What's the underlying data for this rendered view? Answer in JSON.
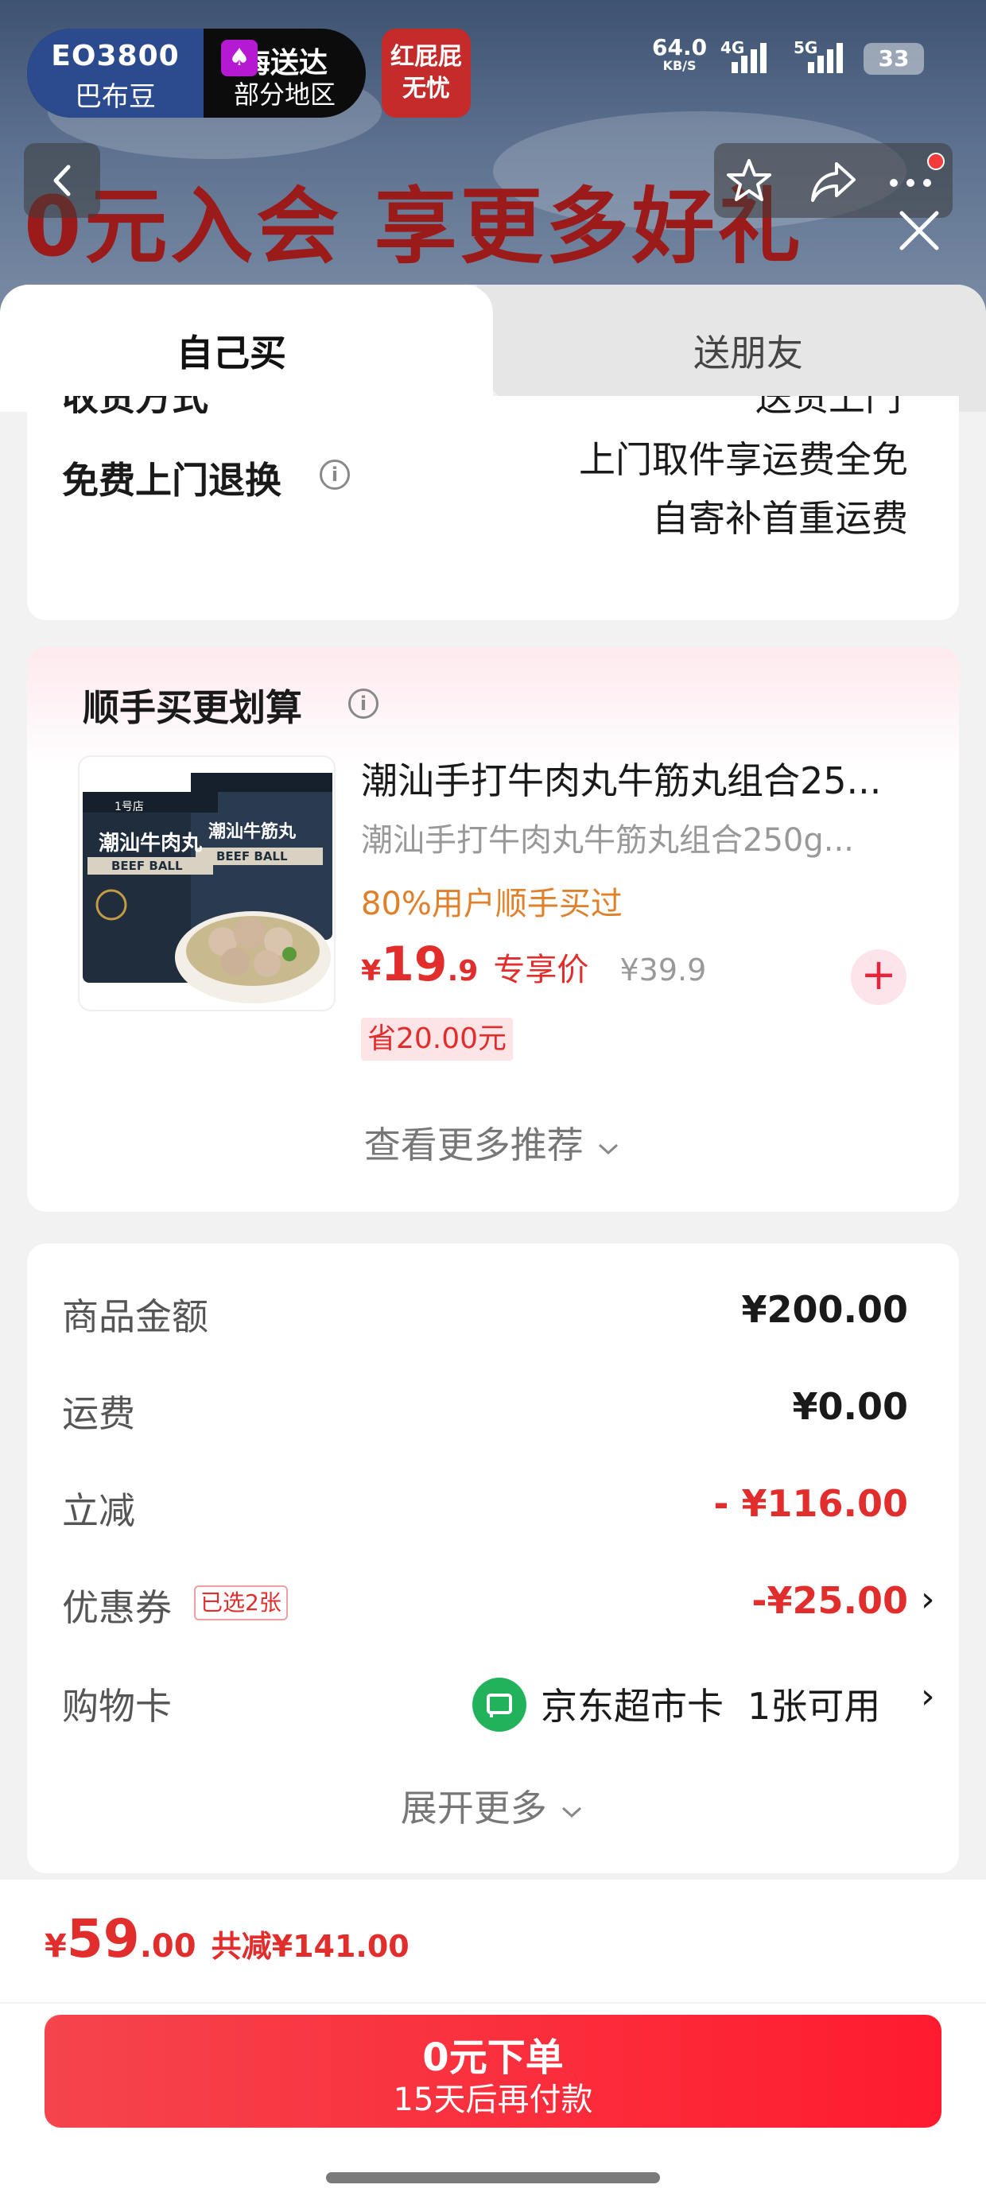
{
  "status_bar": {
    "pill_left_line1": "EO3800",
    "pill_left_line2": "巴布豆",
    "pill_right_line1": "海送达",
    "pill_right_line2": "部分地区",
    "red_badge": "红屁屁\n无忧",
    "net_rate": "64.0",
    "net_unit": "KB/S",
    "sig1": "4G",
    "sig2": "5G",
    "battery": "33"
  },
  "background_page": {
    "hero_text": "0元入会 享更多好礼"
  },
  "tabs": {
    "self": "自己买",
    "friend": "送朋友"
  },
  "delivery": {
    "method_label": "收货方式",
    "method_value": "送货上门",
    "return_label": "免费上门退换",
    "return_line1": "上门取件享运费全免",
    "return_line2": "自寄补首重运费"
  },
  "recommend": {
    "title": "顺手买更划算",
    "product_title": "潮汕手打牛肉丸牛筋丸组合25...",
    "product_subtitle": "潮汕手打牛肉丸牛筋丸组合250g...",
    "social_proof": "80%用户顺手买过",
    "price_symbol": "¥",
    "price_int": "19",
    "price_dec": ".9",
    "price_tag": "专享价",
    "orig_price": "¥39.9",
    "save_badge": "省20.00元",
    "more": "查看更多推荐",
    "image_text_main": "潮汕牛肉丸",
    "image_text_front": "潮汕牛筋丸",
    "image_text_en": "BEEF BALL",
    "image_brand": "1号店"
  },
  "summary": {
    "rows": [
      {
        "label": "商品金额",
        "value": "¥200.00"
      },
      {
        "label": "运费",
        "value": "¥0.00"
      },
      {
        "label": "立减",
        "value": "- ¥116.00"
      },
      {
        "label": "优惠券",
        "value": "-¥25.00",
        "tag": "已选2张"
      },
      {
        "label": "购物卡",
        "value": "京东超市卡",
        "extra": "1张可用"
      }
    ],
    "expand": "展开更多"
  },
  "bottom": {
    "total_symbol": "¥",
    "total_int": "59",
    "total_dec": ".00",
    "total_saved": "共减¥141.00",
    "pay_line1": "0元下单",
    "pay_line2": "15天后再付款"
  },
  "colors": {
    "accent_red": "#e22d2d",
    "button_red": "#ff1b2f",
    "orange": "#e0802a",
    "green": "#21b25b"
  }
}
